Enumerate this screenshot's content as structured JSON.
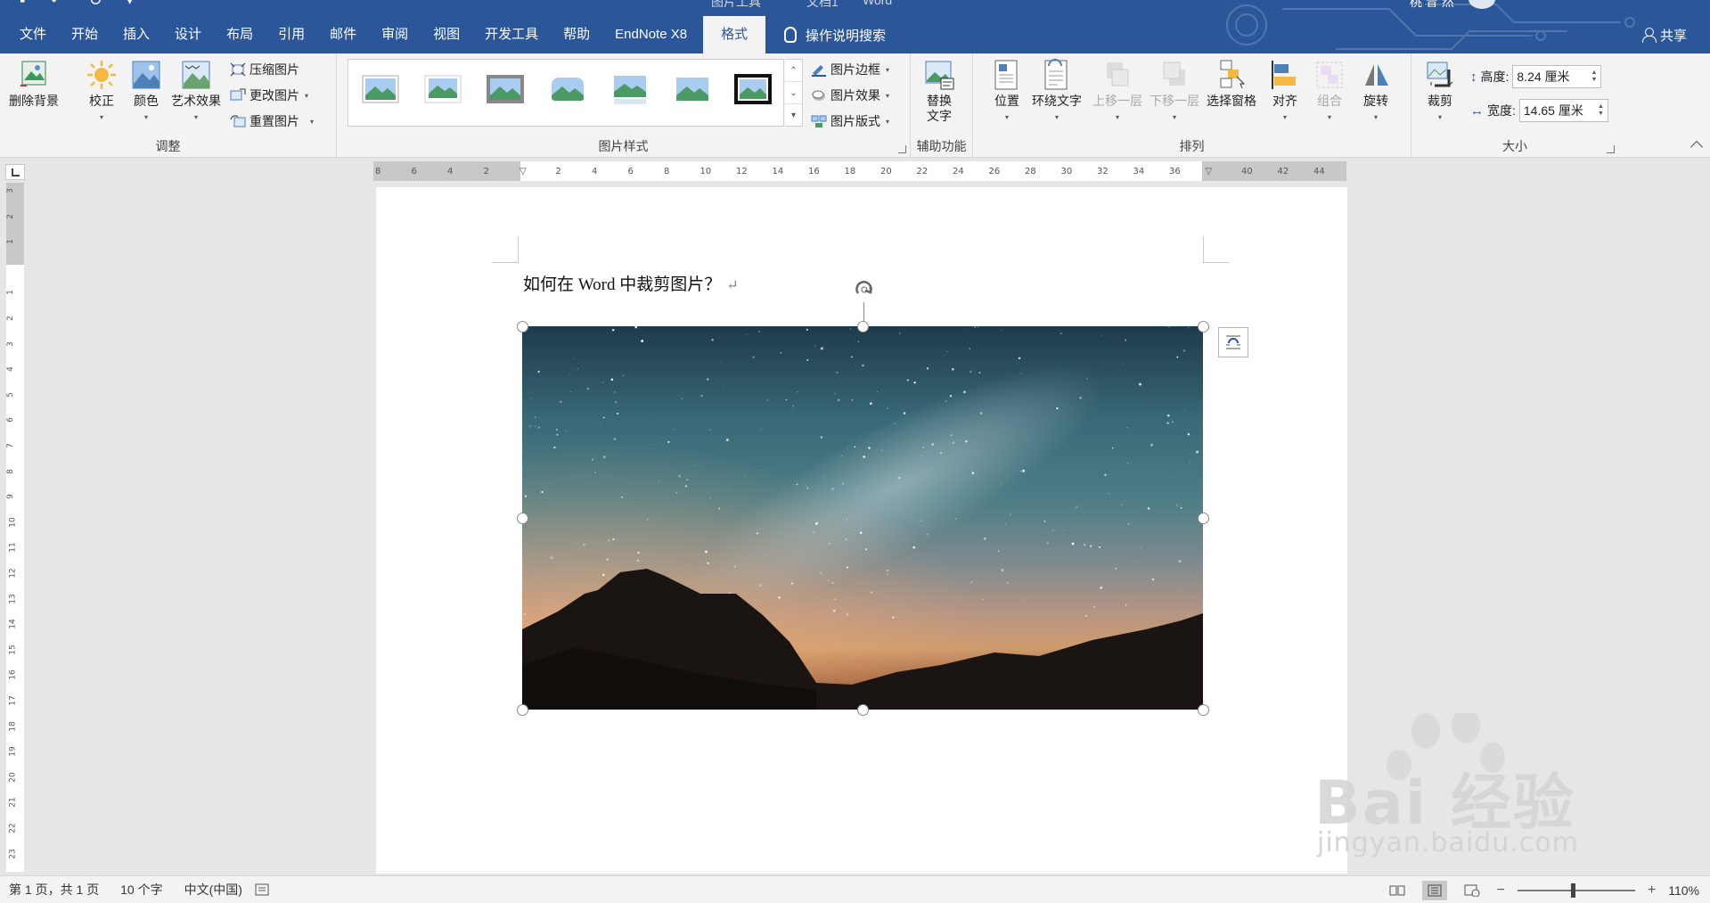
{
  "window": {
    "app_title": "Word",
    "doc_title_partial": "文档1",
    "contextual_tab_header": "图片工具",
    "user": "桃 昔 然"
  },
  "tabs": [
    {
      "label": "文件"
    },
    {
      "label": "开始"
    },
    {
      "label": "插入"
    },
    {
      "label": "设计"
    },
    {
      "label": "布局"
    },
    {
      "label": "引用"
    },
    {
      "label": "邮件"
    },
    {
      "label": "审阅"
    },
    {
      "label": "视图"
    },
    {
      "label": "开发工具"
    },
    {
      "label": "帮助"
    },
    {
      "label": "EndNote X8"
    },
    {
      "label": "格式",
      "active": true
    }
  ],
  "tell_me": "操作说明搜索",
  "share": "共享",
  "ribbon": {
    "adjust": {
      "label": "调整",
      "remove_bg": "删除背景",
      "corrections": "校正",
      "color": "颜色",
      "artistic": "艺术效果",
      "compress": "压缩图片",
      "change": "更改图片",
      "reset": "重置图片"
    },
    "styles": {
      "label": "图片样式",
      "border": "图片边框",
      "effects": "图片效果",
      "layout": "图片版式"
    },
    "accessibility": {
      "label": "辅助功能",
      "alt_text_line1": "替换",
      "alt_text_line2": "文字"
    },
    "arrange": {
      "label": "排列",
      "position": "位置",
      "wrap": "环绕文字",
      "forward": "上移一层",
      "backward": "下移一层",
      "selection_pane": "选择窗格",
      "align": "对齐",
      "group": "组合",
      "rotate": "旋转"
    },
    "size": {
      "label": "大小",
      "crop": "裁剪",
      "height_label": "高度:",
      "height_value": "8.24 厘米",
      "width_label": "宽度:",
      "width_value": "14.65 厘米"
    }
  },
  "ruler": {
    "h_ticks": [
      "8",
      "6",
      "4",
      "2",
      "",
      "2",
      "4",
      "6",
      "8",
      "10",
      "12",
      "14",
      "16",
      "18",
      "20",
      "22",
      "24",
      "26",
      "28",
      "30",
      "32",
      "34",
      "36",
      "",
      "40",
      "42",
      "44"
    ],
    "v_ticks": [
      "3",
      "2",
      "1",
      "",
      "1",
      "2",
      "3",
      "4",
      "5",
      "6",
      "7",
      "8",
      "9",
      "10",
      "11",
      "12",
      "13",
      "14",
      "15",
      "16",
      "17",
      "18",
      "19",
      "20",
      "21",
      "22",
      "23"
    ]
  },
  "document": {
    "text": "如何在 Word 中裁剪图片？",
    "para_mark": "↵"
  },
  "statusbar": {
    "page": "第 1 页，共 1 页",
    "words": "10 个字",
    "language": "中文(中国)",
    "zoom": "110%"
  },
  "watermark": {
    "logo_text": "Bai 经验",
    "url": "jingyan.baidu.com"
  },
  "colors": {
    "title_blue": "#2b579a",
    "ribbon_bg": "#f3f3f3",
    "canvas_bg": "#e6e6e6"
  }
}
